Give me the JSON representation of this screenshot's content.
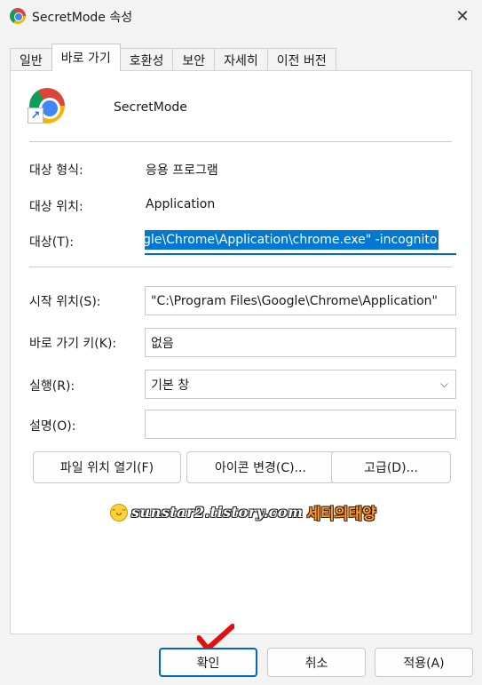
{
  "window": {
    "title": "SecretMode 속성",
    "close_glyph": "✕"
  },
  "tabs": [
    {
      "label": "일반"
    },
    {
      "label": "바로 가기",
      "active": true
    },
    {
      "label": "호환성"
    },
    {
      "label": "보안"
    },
    {
      "label": "자세히"
    },
    {
      "label": "이전 버전"
    }
  ],
  "shortcut": {
    "name": "SecretMode",
    "target_type_label": "대상 형식:",
    "target_type_value": "응용 프로그램",
    "target_location_label": "대상 위치:",
    "target_location_value": "Application",
    "target_label": "대상(T):",
    "target_value": "gle\\Chrome\\Application\\chrome.exe\" -incognito",
    "start_in_label": "시작 위치(S):",
    "start_in_value": "\"C:\\Program Files\\Google\\Chrome\\Application\"",
    "shortcut_key_label": "바로 가기 키(K):",
    "shortcut_key_value": "없음",
    "run_label": "실행(R):",
    "run_value": "기본 창",
    "comment_label": "설명(O):",
    "comment_value": ""
  },
  "panel_buttons": {
    "open_location": "파일 위치 열기(F)",
    "change_icon": "아이콘 변경(C)...",
    "advanced": "고급(D)..."
  },
  "watermark": {
    "url": "sunstar2.tistory.com",
    "name": "세티의태양"
  },
  "footer": {
    "ok": "확인",
    "cancel": "취소",
    "apply": "적용(A)"
  },
  "colors": {
    "accent": "#0067c0",
    "selection": "#0078d4",
    "annotation_check": "#e01010"
  },
  "icons": [
    "chrome-icon",
    "close-icon",
    "shortcut-arrow-icon",
    "chevron-down-icon",
    "smiley-icon",
    "checkmark-annotation-icon"
  ]
}
